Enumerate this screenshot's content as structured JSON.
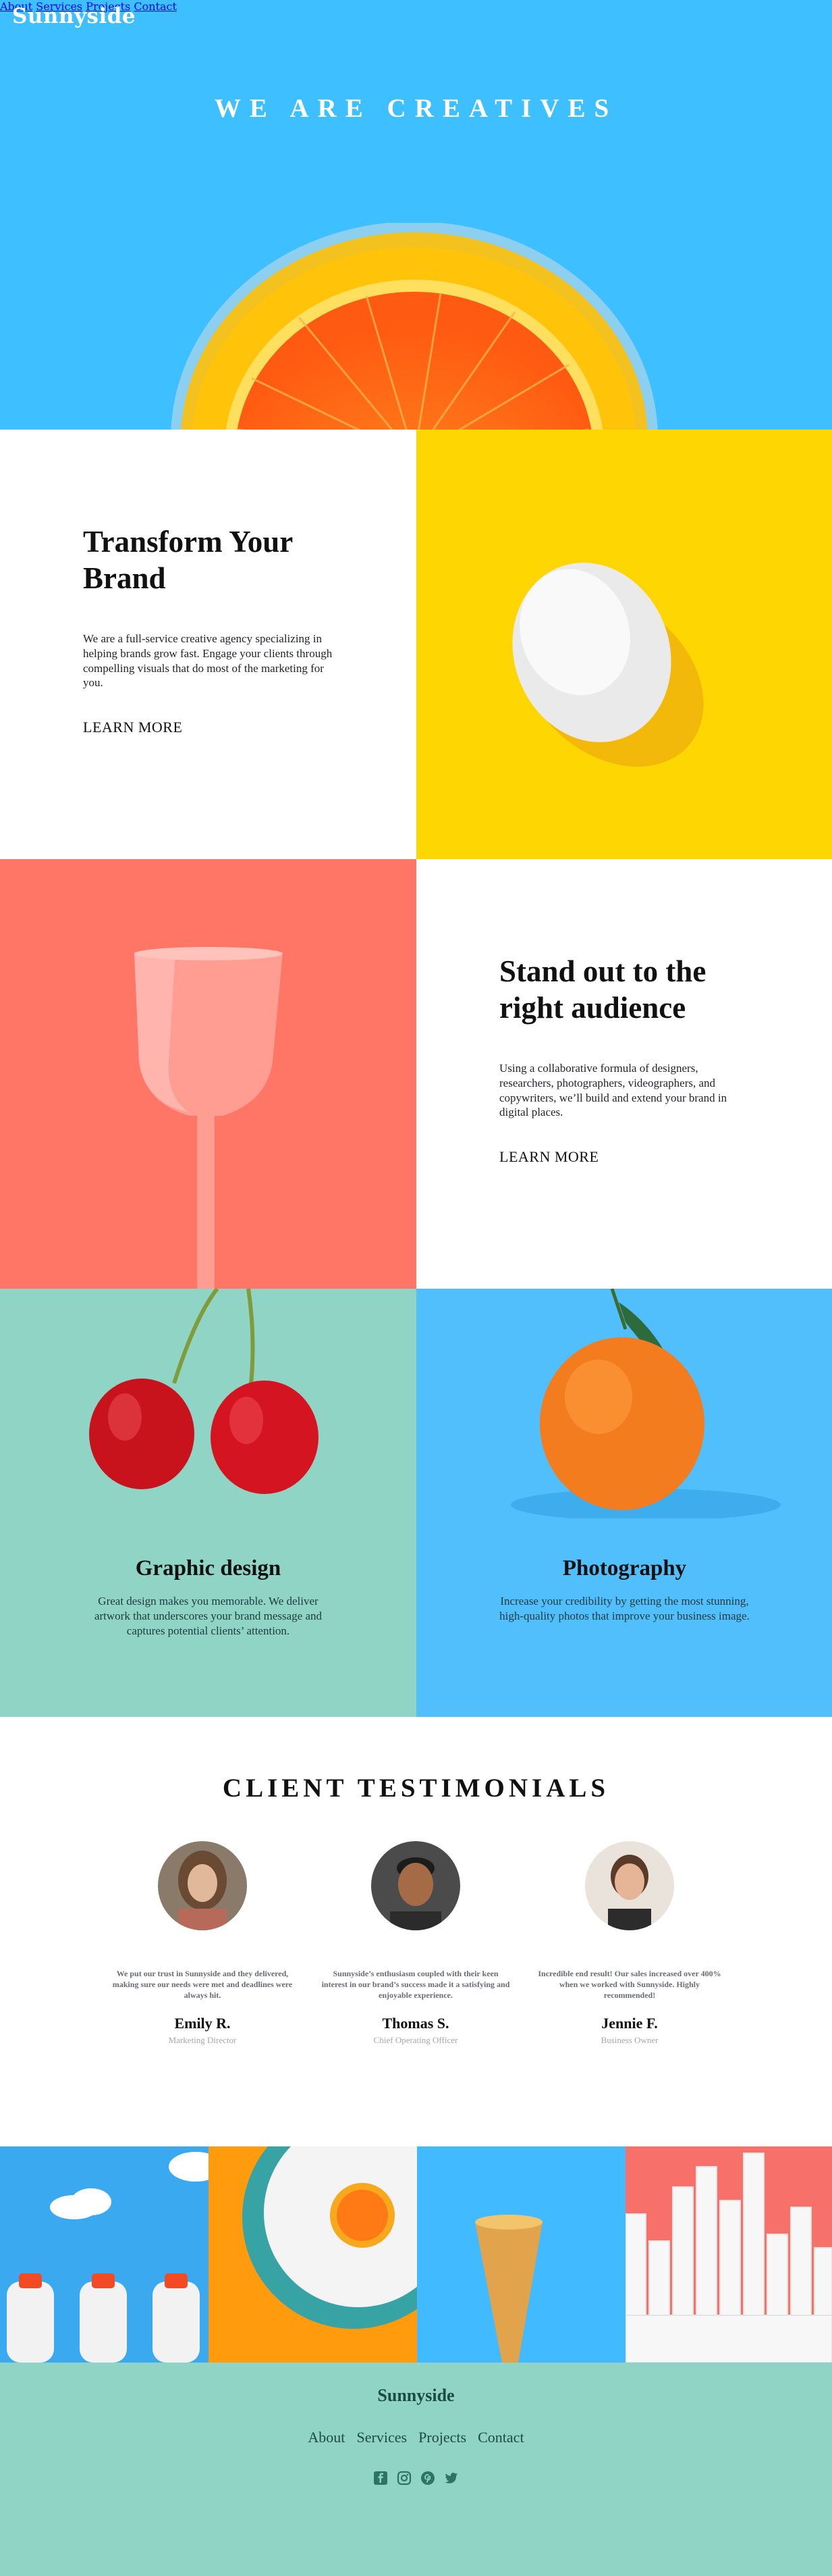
{
  "header": {
    "logo": "Sunnyside",
    "nav": [
      {
        "label": "About"
      },
      {
        "label": "Services"
      },
      {
        "label": "Projects"
      },
      {
        "label": "Contact"
      }
    ]
  },
  "hero": {
    "title": "WE ARE CREATIVES"
  },
  "features": [
    {
      "title": "Transform Your Brand",
      "body": "We are a full-service creative agency specializing in helping brands grow fast. Engage your clients through compelling visuals that do most of the marketing for you.",
      "link": "LEARN MORE"
    },
    {
      "title": "Stand out to the right audience",
      "body": "Using a collaborative formula of designers, researchers, photographers, videographers, and copywriters, we’ll build and extend your brand in digital places.",
      "link": "LEARN MORE"
    }
  ],
  "services": [
    {
      "title": "Graphic design",
      "body": "Great design makes you memorable. We deliver artwork that underscores your brand message and captures potential clients’ attention."
    },
    {
      "title": "Photography",
      "body": "Increase your credibility by getting the most stunning, high-quality photos that improve your business image."
    }
  ],
  "testimonials": {
    "title": "CLIENT TESTIMONIALS",
    "items": [
      {
        "quote": "We put our trust in Sunnyside and they delivered, making sure our needs were met and deadlines were always hit.",
        "name": "Emily R.",
        "role": "Marketing Director"
      },
      {
        "quote": "Sunnyside’s enthusiasm coupled with their keen interest in our brand’s success made it a satisfying and enjoyable experience.",
        "name": "Thomas S.",
        "role": "Chief Operating Officer"
      },
      {
        "quote": "Incredible end result! Our sales increased over 400% when we worked with Sunnyside. Highly recommended!",
        "name": "Jennie F.",
        "role": "Business Owner"
      }
    ]
  },
  "footer": {
    "logo": "Sunnyside",
    "nav": [
      {
        "label": "About"
      },
      {
        "label": "Services"
      },
      {
        "label": "Projects"
      },
      {
        "label": "Contact"
      }
    ],
    "social": [
      "facebook-icon",
      "instagram-icon",
      "pinterest-icon",
      "twitter-icon"
    ]
  },
  "colors": {
    "hero_bg": "#3ebfff",
    "egg_bg": "#fed602",
    "glass_bg": "#ff6a59",
    "graphic_bg": "#90d4c5",
    "photo_bg": "#50bffb",
    "footer_bg": "#90d4c5"
  }
}
